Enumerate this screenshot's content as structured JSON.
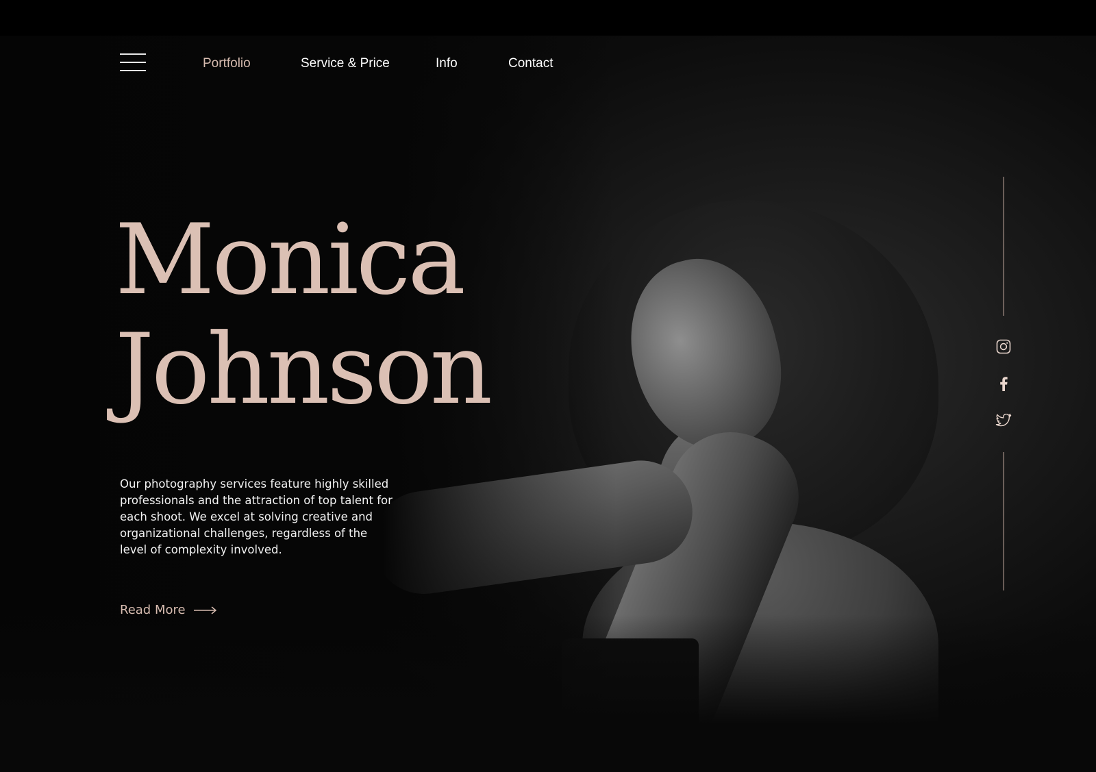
{
  "colors": {
    "accent": "#d7bcb0",
    "background": "#000000",
    "nav_text": "#ffffff",
    "body_text": "#f2f2f2"
  },
  "nav": {
    "menu_icon": "hamburger-menu-icon",
    "items": [
      {
        "label": "Portfolio",
        "active": true
      },
      {
        "label": "Service & Price",
        "active": false
      },
      {
        "label": "Info",
        "active": false
      },
      {
        "label": "Contact",
        "active": false
      }
    ]
  },
  "hero": {
    "first_name": "Monica",
    "last_name": "Johnson",
    "description": "Our photography services feature highly skilled professionals and the attraction of top talent for each shoot. We excel at solving creative and organizational challenges, regardless of the level of complexity involved.",
    "read_more": {
      "label": "Read More",
      "icon": "arrow-right-icon"
    }
  },
  "social": [
    {
      "name": "instagram",
      "icon": "instagram-icon"
    },
    {
      "name": "facebook",
      "icon": "facebook-icon"
    },
    {
      "name": "twitter",
      "icon": "twitter-icon"
    }
  ]
}
